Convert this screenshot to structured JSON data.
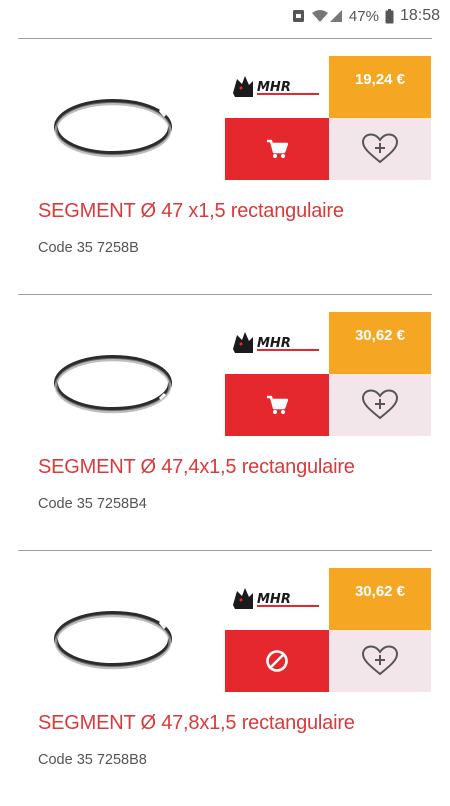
{
  "status_bar": {
    "battery": "47%",
    "time": "18:58",
    "icons": [
      "notification-icon",
      "wifi-icon",
      "signal-icon",
      "battery-icon"
    ]
  },
  "colors": {
    "accent_red": "#e4282d",
    "title_red": "#d93a3a",
    "price_orange": "#f5a623",
    "wishlist_bg": "#f3e6ea"
  },
  "products": [
    {
      "title": "SEGMENT Ø 47 x1,5 rectangulaire",
      "code": "Code 35 7258B",
      "price": "19,24 €",
      "brand": "MHR",
      "action_icon": "cart-icon"
    },
    {
      "title": "SEGMENT Ø 47,4x1,5 rectangulaire",
      "code": "Code 35 7258B4",
      "price": "30,62 €",
      "brand": "MHR",
      "action_icon": "cart-icon"
    },
    {
      "title": "SEGMENT Ø 47,8x1,5 rectangulaire",
      "code": "Code 35 7258B8",
      "price": "30,62 €",
      "brand": "MHR",
      "action_icon": "unavailable-icon"
    }
  ]
}
